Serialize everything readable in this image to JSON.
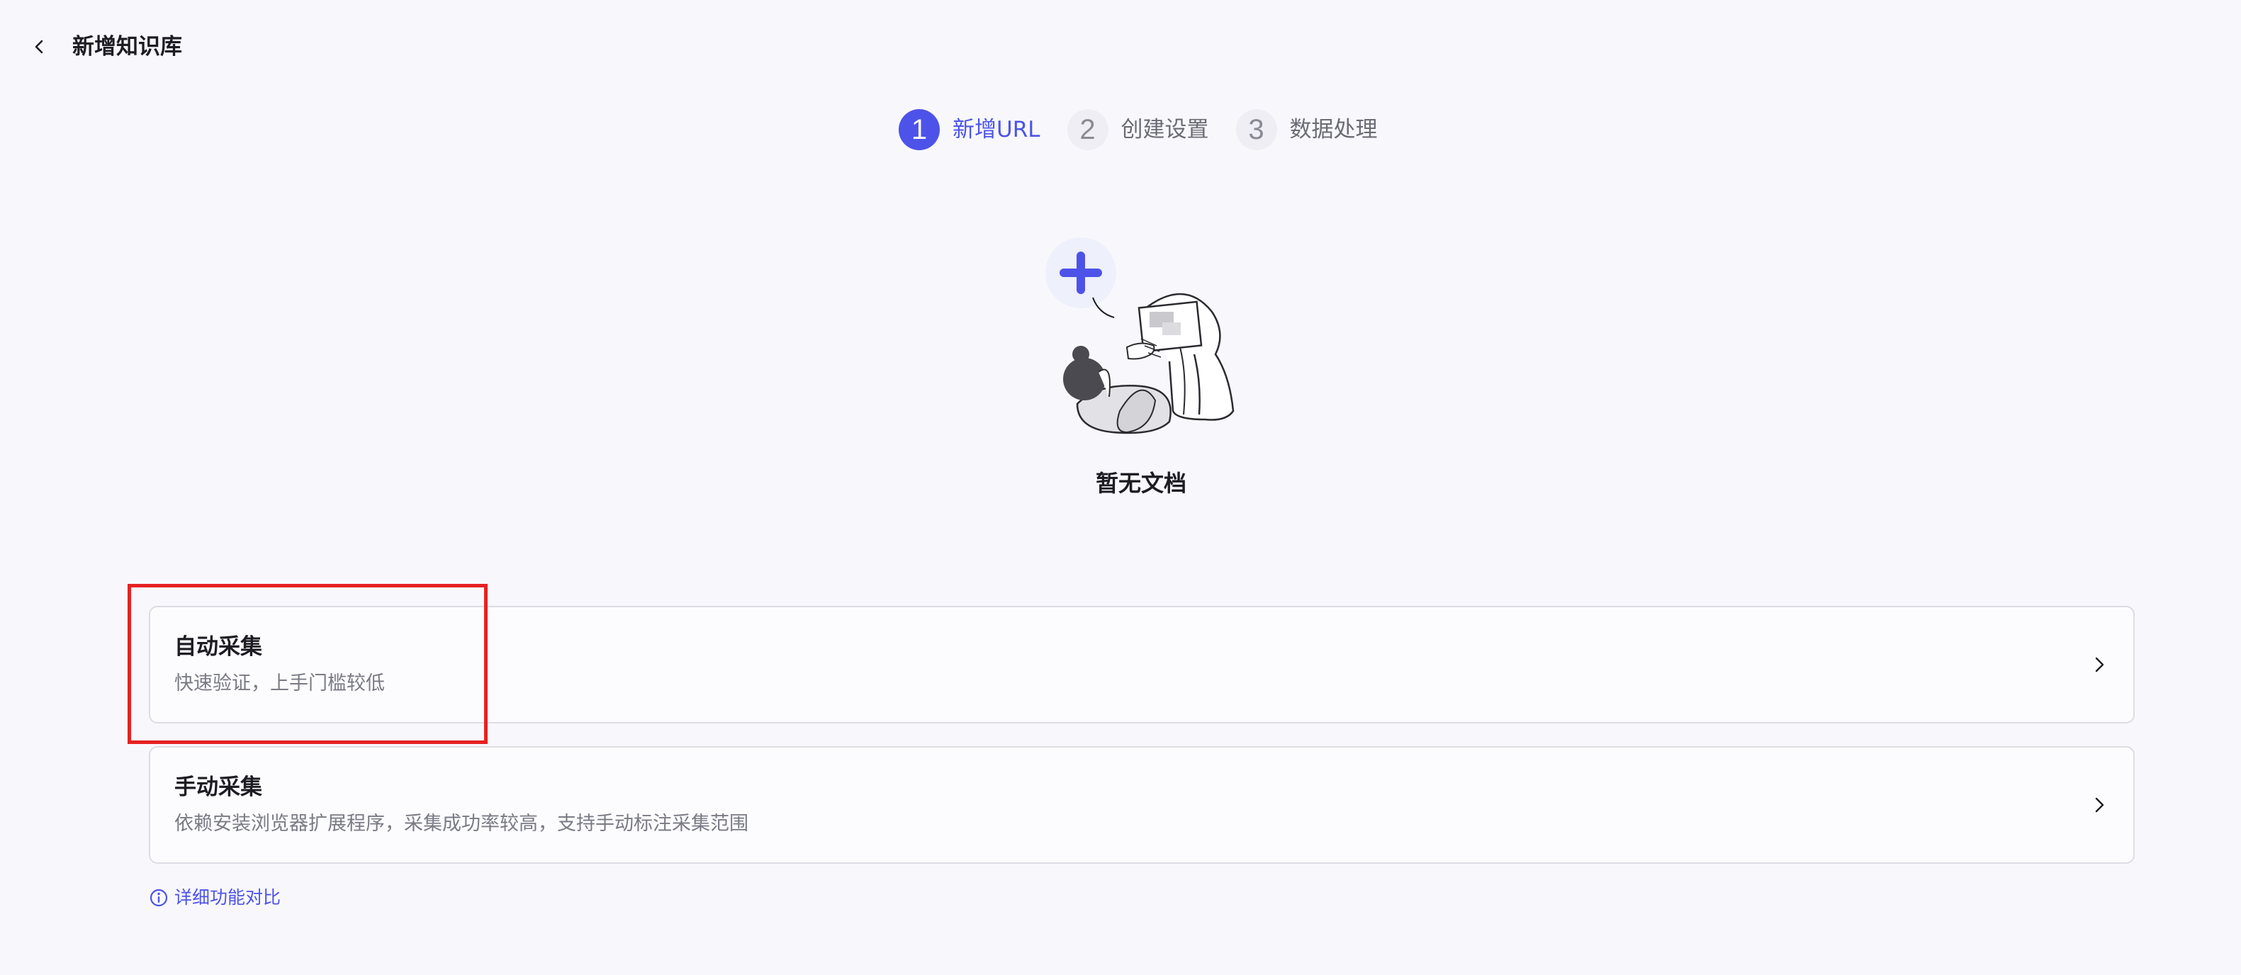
{
  "header": {
    "title": "新增知识库"
  },
  "steps": [
    {
      "number": "1",
      "label": "新增URL",
      "active": true
    },
    {
      "number": "2",
      "label": "创建设置",
      "active": false
    },
    {
      "number": "3",
      "label": "数据处理",
      "active": false
    }
  ],
  "empty_state": {
    "text": "暂无文档"
  },
  "options": [
    {
      "title": "自动采集",
      "description": "快速验证，上手门槛较低",
      "highlighted": true
    },
    {
      "title": "手动采集",
      "description": "依赖安装浏览器扩展程序，采集成功率较高，支持手动标注采集范围",
      "highlighted": false
    }
  ],
  "compare_link": {
    "label": "详细功能对比"
  },
  "colors": {
    "accent": "#4d53e8",
    "highlight": "#e62222",
    "background": "#f8f8fc"
  }
}
